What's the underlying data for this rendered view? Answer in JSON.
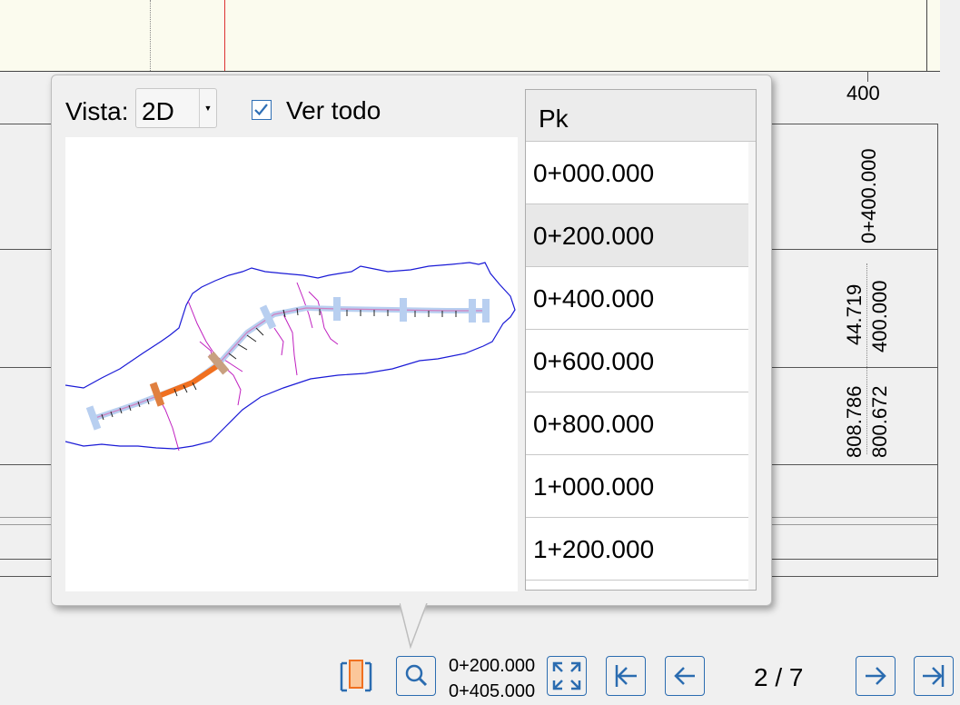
{
  "background": {
    "ruler_label": "400",
    "vertical_values": [
      "0+400.000",
      "44.719",
      "400.000",
      "808.786",
      "800.672"
    ]
  },
  "popup": {
    "vista_label": "Vista:",
    "vista_value": "2D",
    "ver_todo_label": "Ver todo",
    "ver_todo_checked": true,
    "table_header": "Pk",
    "rows": [
      "0+000.000",
      "0+200.000",
      "0+400.000",
      "0+600.000",
      "0+800.000",
      "1+000.000",
      "1+200.000"
    ],
    "selected_row": "0+200.000"
  },
  "toolbar": {
    "pk_start": "0+200.000",
    "pk_end": "0+405.000",
    "page": "2 / 7",
    "buttons": [
      "plan-view-icon",
      "zoom-icon",
      "fit-extents-icon",
      "first-page-icon",
      "previous-page-icon",
      "next-page-icon",
      "last-page-icon"
    ]
  },
  "colors": {
    "accent": "#2b6cb0",
    "selected_segment": "#f07020",
    "boundary": "#1a1ad6",
    "streams": "#c020c0",
    "alignment": "#b8cff0"
  }
}
